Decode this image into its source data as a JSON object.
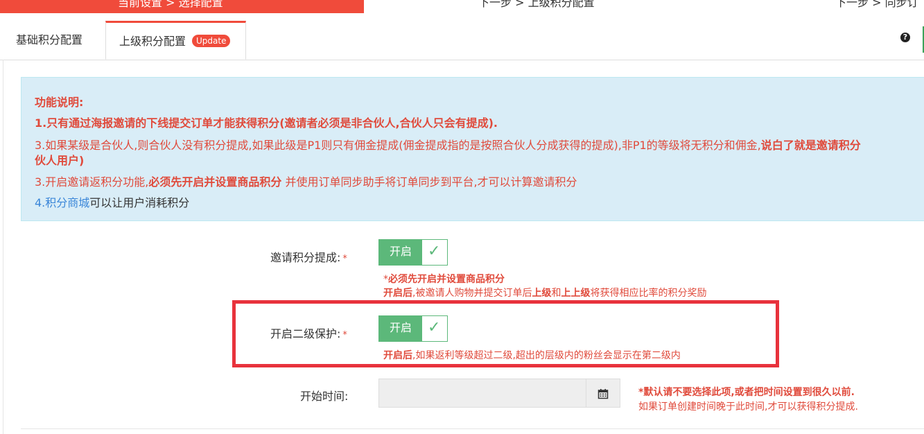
{
  "steps": {
    "step1": "当前设置 > 选择配置",
    "step2": "下一步 > 上级积分配置",
    "step3": "下一步 > 同步订"
  },
  "tabs": {
    "basic": "基础积分配置",
    "upper": "上级积分配置",
    "upper_badge": "Update"
  },
  "help_icon": "?",
  "info": {
    "title": "功能说明:",
    "line1": "1.只有通过海报邀请的下线提交订单才能获得积分(邀请者必须是非合伙人,合伙人只会有提成).",
    "line2_normal": "3.如果某级是合伙人,则合伙人没有积分提成,如果此级是P1则只有佣金提成(佣金提成指的是按照合伙人分成获得的提成),非P1的等级将无积分和佣金,",
    "line2_bold": "说白了就是邀请积分",
    "line2_cont": "伙人用户)",
    "line3_prefix": "3.开启邀请返积分功能,",
    "line3_bold": "必须先开启并设置商品积分",
    "line3_suffix": " 并使用订单同步助手将订单同步到平台,才可以计算邀请积分",
    "line4_prefix": "4.",
    "line4_link": "积分商城",
    "line4_suffix": "可以让用户消耗积分"
  },
  "form": {
    "invite_label": "邀请积分提成:",
    "invite_toggle": "开启",
    "invite_hint1_star": "*",
    "invite_hint1": "必须先开启并设置商品积分",
    "invite_hint2_b1": "开启后",
    "invite_hint2_t1": ",被邀请人购物并提交订单后",
    "invite_hint2_b2": "上级",
    "invite_hint2_t2": "和",
    "invite_hint2_b3": "上上级",
    "invite_hint2_t3": "将获得相应比率的积分奖励",
    "protect_label": "开启二级保护:",
    "protect_toggle": "开启",
    "protect_hint_b": "开启后",
    "protect_hint": ",如果返利等级超过二级,超出的层级内的粉丝会显示在第二级内",
    "start_label": "开始时间:",
    "start_value": "",
    "start_hint1": "*默认请不要选择此项,或者把时间设置到很久以前.",
    "start_hint2": "如果订单创建时间晚于此时间,才可以获得积分提成."
  },
  "required_mark": "*",
  "check_glyph": "✓",
  "calendar_icon": "calendar-icon",
  "colors": {
    "accent_red": "#f04b3b",
    "toggle_green": "#5cb87a",
    "info_bg": "#d9edf7",
    "highlight_red": "#e8323c",
    "link_blue": "#3a86d8"
  }
}
